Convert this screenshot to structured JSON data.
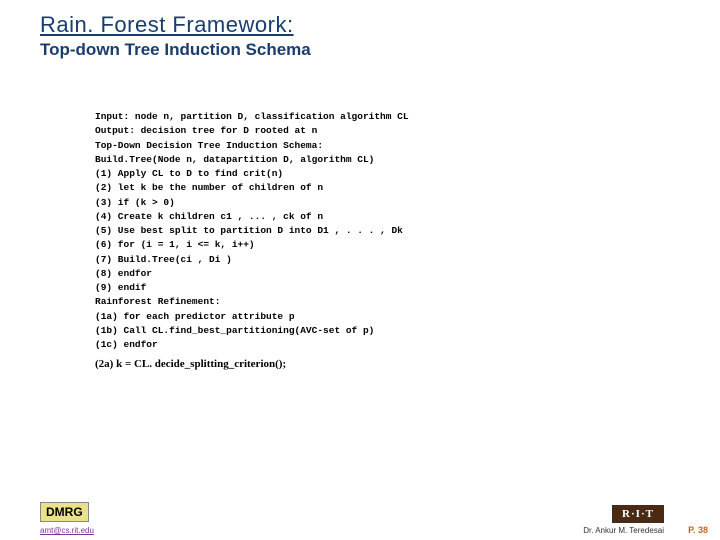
{
  "header": {
    "title": "Rain. Forest Framework:",
    "subtitle": "Top-down Tree Induction Schema"
  },
  "code": {
    "lines": [
      "Input: node n, partition D, classification algorithm CL",
      "Output: decision tree for D rooted at n",
      "Top-Down Decision Tree Induction Schema:",
      "Build.Tree(Node n, datapartition D, algorithm CL)",
      "(1) Apply CL to D to find crit(n)",
      "(2) let k be the number of children of n",
      "(3) if (k > 0)",
      "(4) Create k children c1 , ... , ck of n",
      "(5) Use best split to partition D into D1 , . . . , Dk",
      "(6) for (i = 1, i <= k, i++)",
      "(7) Build.Tree(ci , Di )",
      "(8) endfor",
      "(9) endif",
      "Rainforest Refinement:",
      "(1a) for each predictor attribute p",
      "(1b) Call CL.find_best_partitioning(AVC-set of p)",
      "(1c) endfor"
    ],
    "footer_line": "(2a) k = CL. decide_splitting_criterion();"
  },
  "footer": {
    "badge": "DMRG",
    "link": "amt@cs.rit.edu",
    "rit": "R·I·T",
    "author": "Dr. Ankur M. Teredesai",
    "page": "P. 38"
  }
}
